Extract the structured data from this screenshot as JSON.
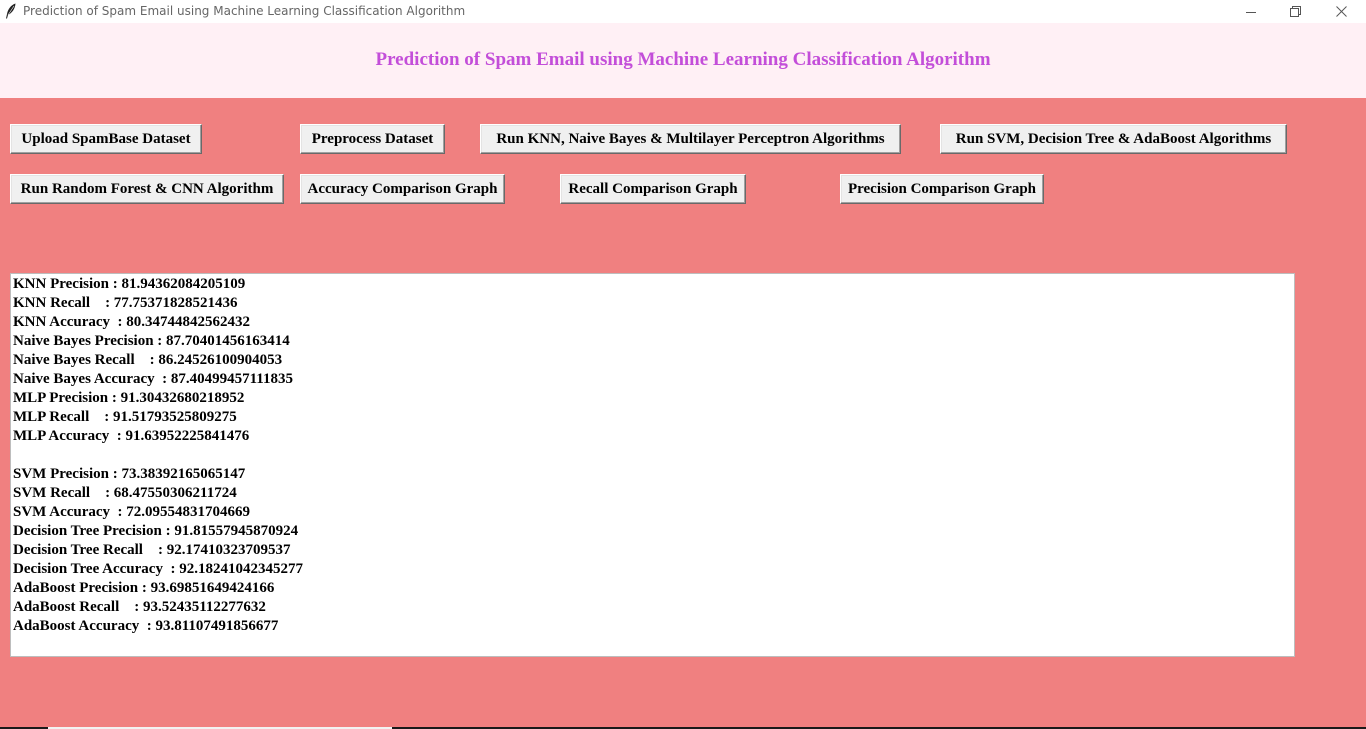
{
  "window": {
    "title": "Prediction of Spam Email using Machine Learning Classification Algorithm",
    "app_icon": "feather-icon",
    "controls": [
      "minimize-icon",
      "restore-icon",
      "close-icon"
    ]
  },
  "header": {
    "title": "Prediction of Spam Email using Machine Learning Classification Algorithm"
  },
  "buttons": {
    "upload": "Upload SpamBase Dataset",
    "preprocess": "Preprocess Dataset",
    "run_knn_nb_mlp": "Run KNN, Naive Bayes & Multilayer Perceptron Algorithms",
    "run_svm_dt_ada": "Run SVM, Decision Tree & AdaBoost Algorithms",
    "run_rf_cnn": "Run Random Forest & CNN Algorithm",
    "accuracy_graph": "Accuracy Comparison Graph",
    "recall_graph": "Recall Comparison Graph",
    "precision_graph": "Precision Comparison Graph"
  },
  "output": {
    "lines": [
      "KNN Precision : 81.94362084205109",
      "KNN Recall    : 77.75371828521436",
      "KNN Accuracy  : 80.34744842562432",
      "Naive Bayes Precision : 87.70401456163414",
      "Naive Bayes Recall    : 86.24526100904053",
      "Naive Bayes Accuracy  : 87.40499457111835",
      "MLP Precision : 91.30432680218952",
      "MLP Recall    : 91.51793525809275",
      "MLP Accuracy  : 91.63952225841476",
      "",
      "SVM Precision : 73.38392165065147",
      "SVM Recall    : 68.47550306211724",
      "SVM Accuracy  : 72.09554831704669",
      "Decision Tree Precision : 91.81557945870924",
      "Decision Tree Recall    : 92.17410323709537",
      "Decision Tree Accuracy  : 92.18241042345277",
      "AdaBoost Precision : 93.69851649424166",
      "AdaBoost Recall    : 93.52435112277632",
      "AdaBoost Accuracy  : 93.81107491856677"
    ]
  },
  "colors": {
    "background": "#f08080",
    "header_background": "#fff0f5",
    "header_text": "#c34ed9",
    "button_face": "#f0f0f0",
    "output_background": "#ffffff"
  }
}
